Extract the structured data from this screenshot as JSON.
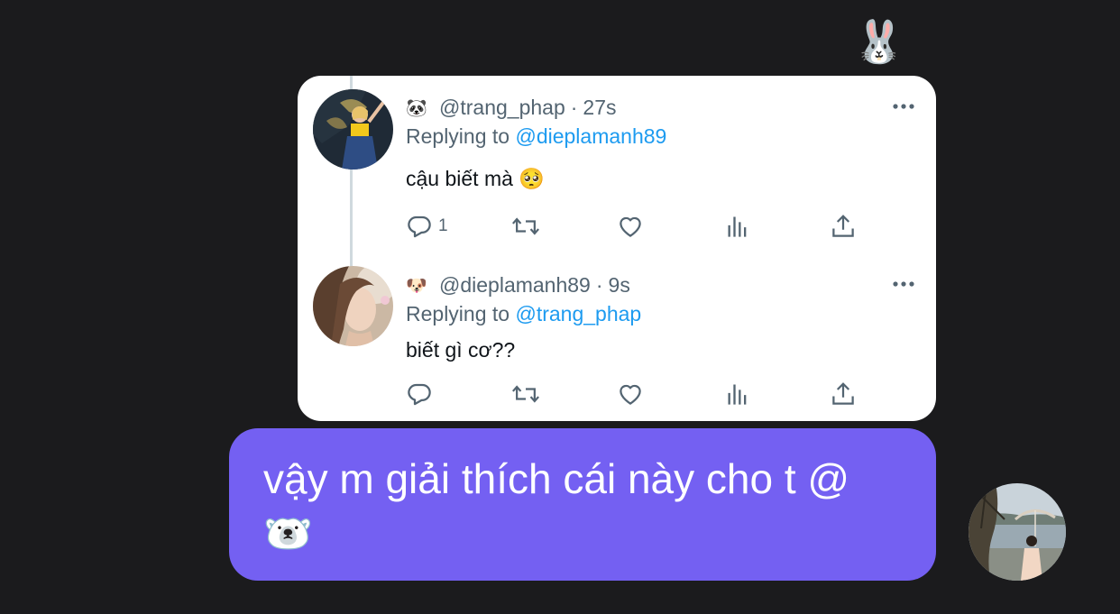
{
  "reaction": {
    "emoji": "🐰",
    "icon": "rabbit-face-emoji"
  },
  "thread": [
    {
      "name_emoji": "🐼",
      "handle": "@trang_phap",
      "separator": "·",
      "time": "27s",
      "replying_prefix": "Replying to",
      "replying_to": "@dieplamanh89",
      "text": "cậu biết mà 🥺",
      "reply_count": "1",
      "icons": [
        "reply-icon",
        "retweet-icon",
        "like-icon",
        "views-icon",
        "share-icon"
      ]
    },
    {
      "name_emoji": "🐶",
      "handle": "@dieplamanh89",
      "separator": "·",
      "time": "9s",
      "replying_prefix": "Replying to",
      "replying_to": "@trang_phap",
      "text": "biết gì cơ??",
      "reply_count": "",
      "icons": [
        "reply-icon",
        "retweet-icon",
        "like-icon",
        "views-icon",
        "share-icon"
      ]
    }
  ],
  "message": {
    "text": "vậy m giải thích cái này cho t @",
    "emoji": "🐻‍❄️",
    "bubble_color": "#7460f2"
  },
  "colors": {
    "background": "#1b1b1d",
    "card": "#ffffff",
    "secondary_text": "#536471",
    "mention": "#1d9bf0",
    "primary_text": "#0f1419"
  }
}
